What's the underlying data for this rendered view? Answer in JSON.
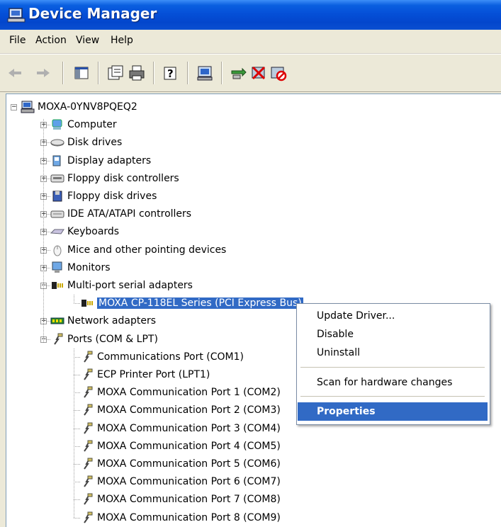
{
  "window": {
    "title": "Device Manager"
  },
  "menu": [
    "File",
    "Action",
    "View",
    "Help"
  ],
  "toolbar": {
    "icons": [
      "back-arrow-icon",
      "forward-arrow-icon",
      "show-hide-tree-icon",
      "properties-icon",
      "print-icon",
      "help-icon",
      "scan-hardware-icon",
      "update-driver-icon",
      "uninstall-icon",
      "disable-icon"
    ]
  },
  "tree": {
    "root": "MOXA-0YNV8PQEQ2",
    "categories": [
      "Computer",
      "Disk drives",
      "Display adapters",
      "Floppy disk controllers",
      "Floppy disk drives",
      "IDE ATA/ATAPI controllers",
      "Keyboards",
      "Mice and other pointing devices",
      "Monitors",
      "Multi-port serial adapters"
    ],
    "multiport_child": "MOXA CP-118EL Series (PCI Express Bus)",
    "network": "Network adapters",
    "ports": "Ports (COM & LPT)",
    "port_children": [
      "Communications Port (COM1)",
      "ECP Printer Port (LPT1)",
      "MOXA Communication Port 1 (COM2)",
      "MOXA Communication Port 2 (COM3)",
      "MOXA Communication Port 3 (COM4)",
      "MOXA Communication Port 4 (COM5)",
      "MOXA Communication Port 5 (COM6)",
      "MOXA Communication Port 6 (COM7)",
      "MOXA Communication Port 7 (COM8)",
      "MOXA Communication Port 8 (COM9)"
    ],
    "expander_plus": "+",
    "expander_minus": "−"
  },
  "context_menu": {
    "items": [
      "Update Driver...",
      "Disable",
      "Uninstall",
      "Scan for hardware changes",
      "Properties"
    ]
  },
  "colors": {
    "title_blue": "#0550d8",
    "selection": "#316AC5"
  }
}
